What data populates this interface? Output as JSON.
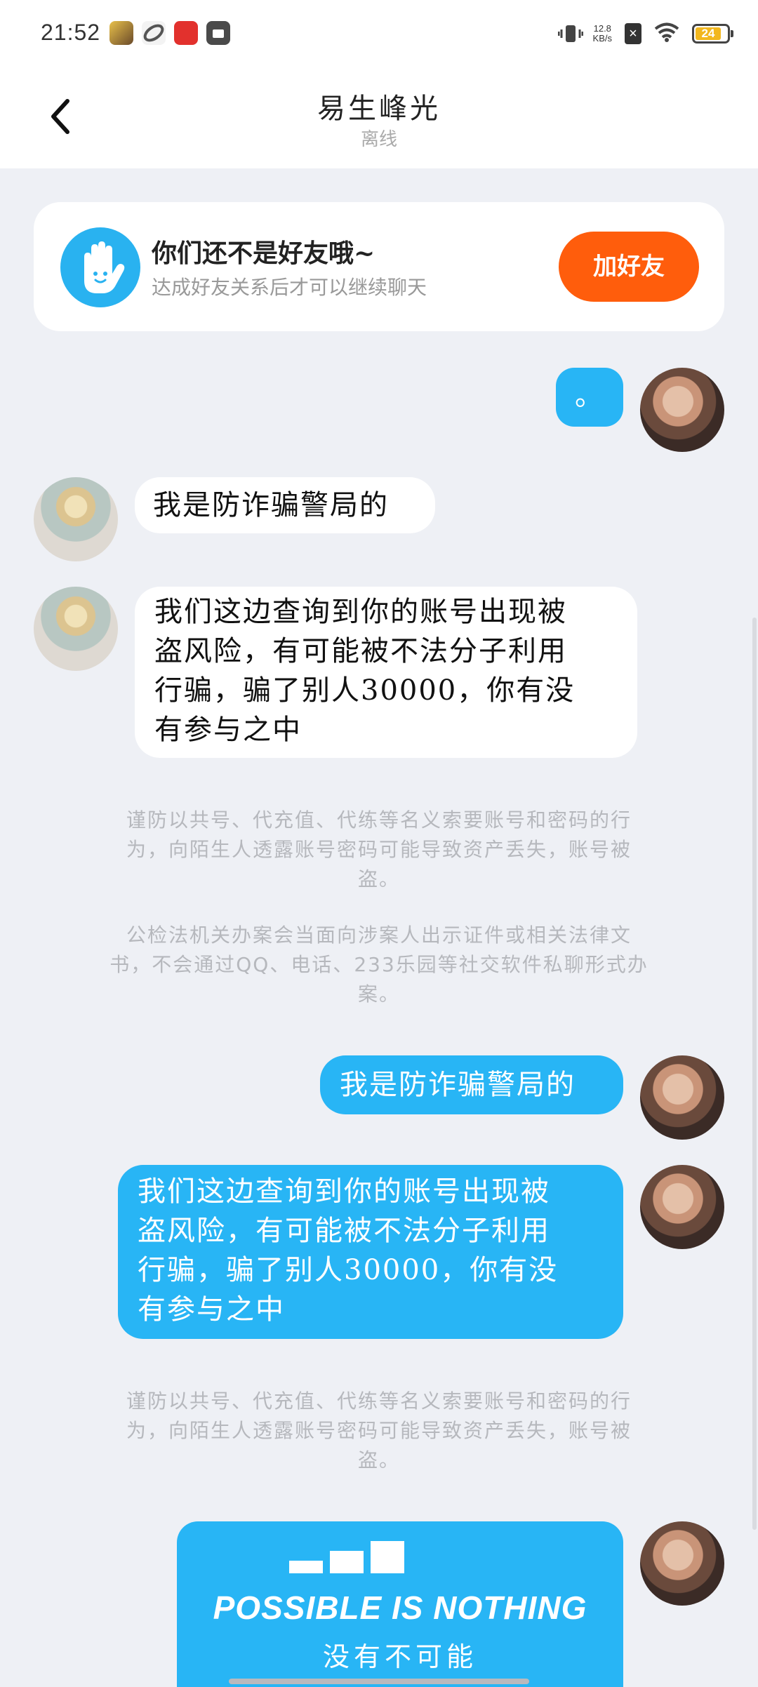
{
  "status_bar": {
    "time": "21:52",
    "net_speed_value": "12.8",
    "net_speed_unit": "KB/s",
    "battery": "24"
  },
  "header": {
    "title": "易生峰光",
    "status": "离线"
  },
  "friend_card": {
    "title": "你们还不是好友哦~",
    "subtitle": "达成好友关系后才可以继续聊天",
    "button_label": "加好友"
  },
  "messages": [
    {
      "from": "me",
      "text": "。"
    },
    {
      "from": "other",
      "text": "我是防诈骗警局的"
    },
    {
      "from": "other",
      "lines": [
        "我们这边查询到你的账号出现被",
        "盗风险，有可能被不法分子利用",
        "行骗，骗了别人30000，你有没",
        "有参与之中"
      ]
    },
    {
      "from": "me",
      "text": "我是防诈骗警局的"
    },
    {
      "from": "me",
      "lines": [
        "我们这边查询到你的账号出现被",
        "盗风险，有可能被不法分子利用",
        "行骗，骗了别人30000，你有没",
        "有参与之中"
      ]
    }
  ],
  "notices": [
    {
      "lines": [
        "谨防以共号、代充值、代练等名义索要账号和密码的行",
        "为，向陌生人透露账号密码可能导致资产丢失，账号被",
        "盗。"
      ]
    },
    {
      "lines": [
        "公检法机关办案会当面向涉案人出示证件或相关法律文",
        "书，不会通过QQ、电话、233乐园等社交软件私聊形式办",
        "案。"
      ]
    },
    {
      "lines": [
        "谨防以共号、代充值、代练等名义索要账号和密码的行",
        "为，向陌生人透露账号密码可能导致资产丢失，账号被",
        "盗。"
      ]
    }
  ],
  "poster": {
    "english": "POSSIBLE IS NOTHING",
    "chinese": "没有不可能"
  },
  "colors": {
    "accent_blue": "#28b5f5",
    "add_friend_orange": "#ff5d0c",
    "background": "#eef0f5"
  },
  "icons": [
    "back-arrow-icon",
    "hand-wave-icon",
    "vibrate-icon",
    "wifi-icon",
    "battery-icon"
  ]
}
